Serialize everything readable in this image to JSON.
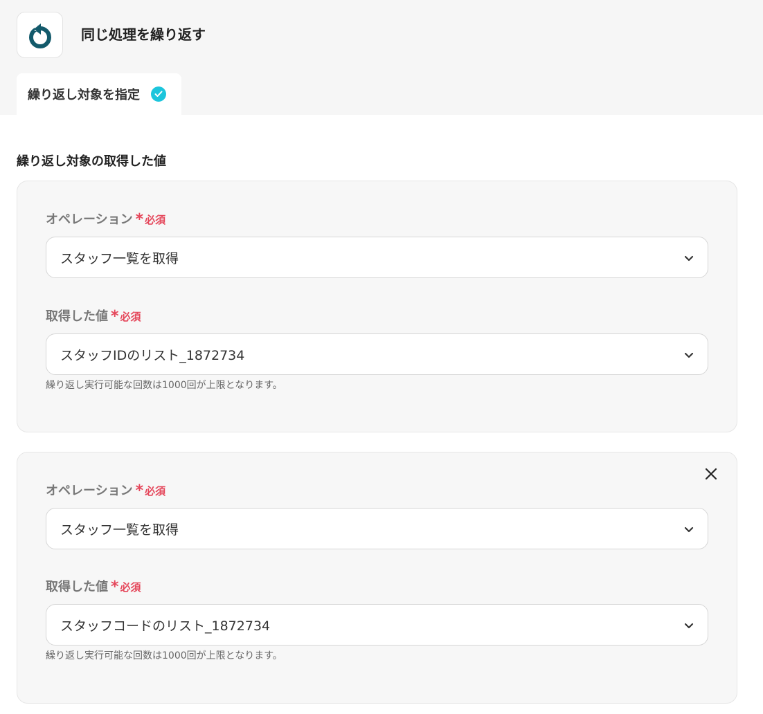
{
  "header": {
    "title": "同じ処理を繰り返す",
    "app_icon": "refresh-icon",
    "brand_color": "#135a6b"
  },
  "tab": {
    "label": "繰り返し対象を指定",
    "check_color": "#1cc5dc"
  },
  "section": {
    "title": "繰り返し対象の取得した値"
  },
  "required": {
    "star": "*",
    "text": "必須",
    "color": "#e5475b"
  },
  "groups": [
    {
      "operation_label": "オペレーション",
      "operation_value": "スタッフ一覧を取得",
      "value_label": "取得した値",
      "value_value": "スタッフIDのリスト_1872734",
      "help_text": "繰り返し実行可能な回数は1000回が上限となります。",
      "removable": false
    },
    {
      "operation_label": "オペレーション",
      "operation_value": "スタッフ一覧を取得",
      "value_label": "取得した値",
      "value_value": "スタッフコードのリスト_1872734",
      "help_text": "繰り返し実行可能な回数は1000回が上限となります。",
      "removable": true
    }
  ]
}
